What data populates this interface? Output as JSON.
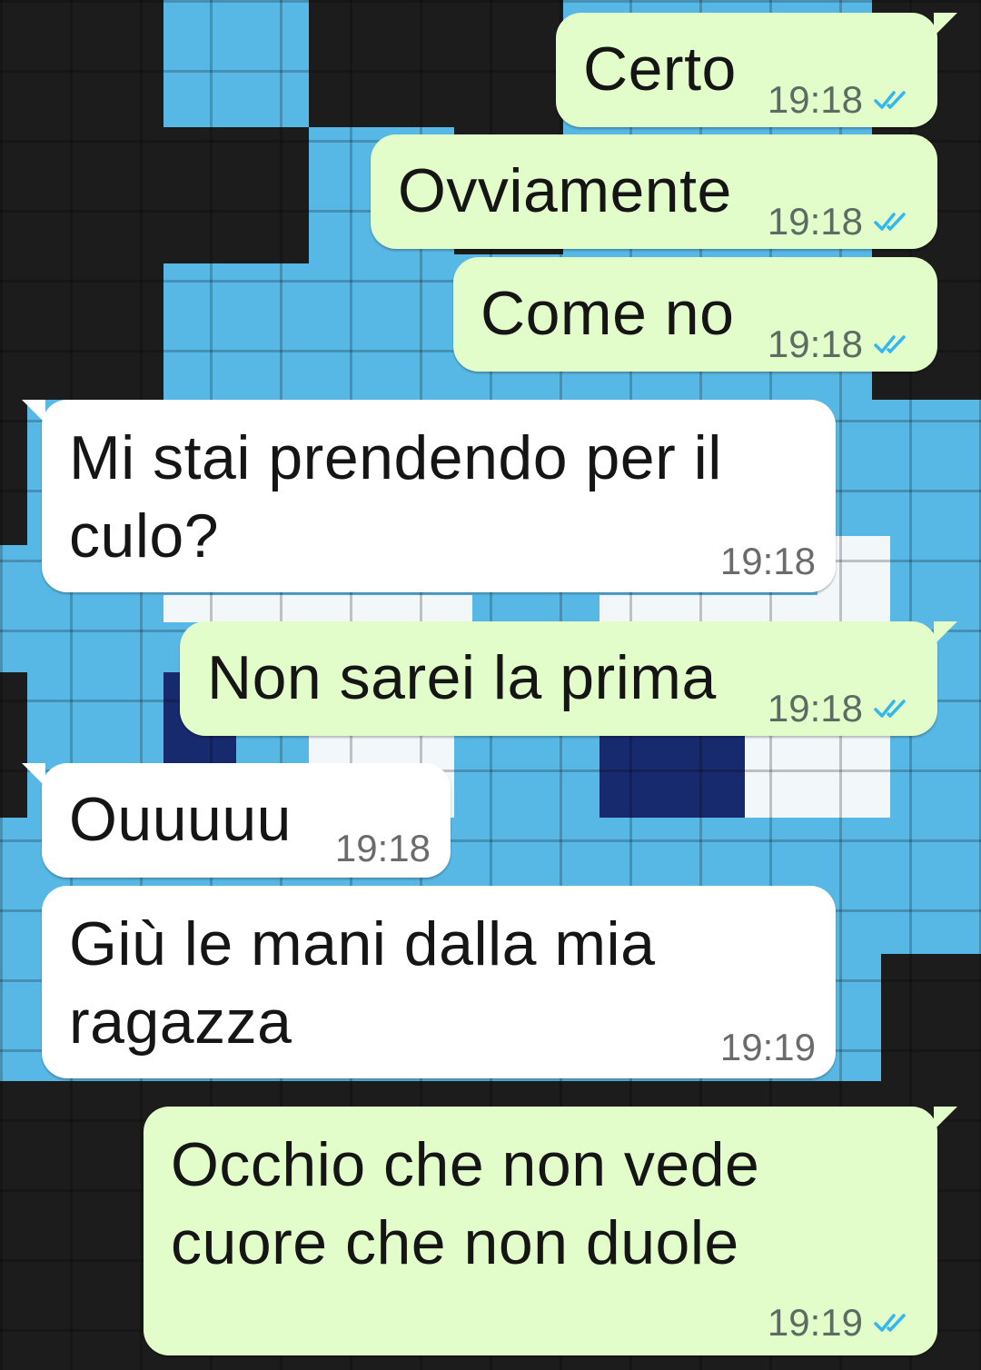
{
  "colors": {
    "outgoing_bubble": "#e2fdc9",
    "incoming_bubble": "#ffffff",
    "read_ticks": "#34b7f1",
    "wallpaper_light": "#58b8e5",
    "wallpaper_dark": "#1a1a1a",
    "wallpaper_navy": "#182a6e",
    "wallpaper_white": "#f2f7fa"
  },
  "messages": [
    {
      "dir": "out",
      "lines": [
        "Certo"
      ],
      "time": "19:18",
      "read": true
    },
    {
      "dir": "out",
      "lines": [
        "Ovviamente"
      ],
      "time": "19:18",
      "read": true
    },
    {
      "dir": "out",
      "lines": [
        "Come no"
      ],
      "time": "19:18",
      "read": true
    },
    {
      "dir": "in",
      "lines": [
        "Mi stai prendendo per il",
        "culo?"
      ],
      "time": "19:18"
    },
    {
      "dir": "out",
      "lines": [
        "Non sarei la prima"
      ],
      "time": "19:18",
      "read": true
    },
    {
      "dir": "in",
      "lines": [
        "Ouuuuu"
      ],
      "time": "19:18"
    },
    {
      "dir": "in",
      "lines": [
        "Giù le mani dalla mia",
        "ragazza"
      ],
      "time": "19:19"
    },
    {
      "dir": "out",
      "lines": [
        "Occhio che non vede",
        "cuore che non duole"
      ],
      "time": "19:19",
      "read": true
    }
  ]
}
